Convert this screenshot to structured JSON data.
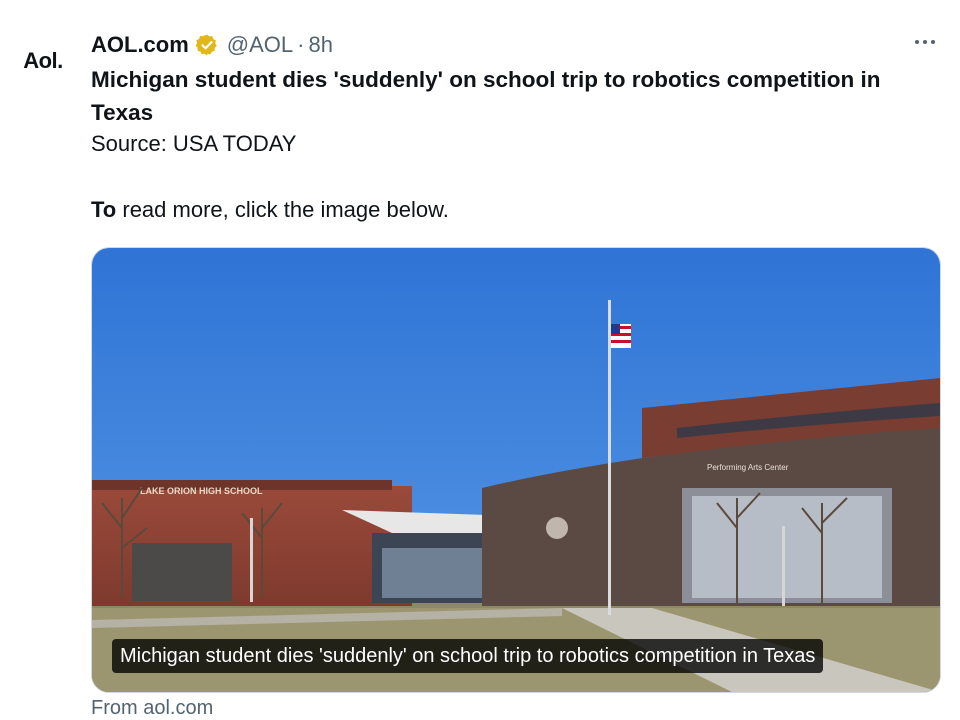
{
  "tweet": {
    "avatar_text": "Aol.",
    "author": "AOL.com",
    "handle": "@AOL",
    "separator": "·",
    "time": "8h",
    "headline": "Michigan student dies 'suddenly' on school trip to robotics competition in Texas",
    "source": "Source: USA TODAY",
    "cta_bold": "To",
    "cta_rest": " read more, click the image below.",
    "from": "From aol.com"
  },
  "media": {
    "caption": "Michigan student dies 'suddenly' on school trip to robotics competition in Texas",
    "building_sign_left": "LAKE ORION HIGH SCHOOL",
    "building_sign_right": "Performing Arts Center"
  },
  "icons": {
    "verified": "verified-gold-badge-icon",
    "more": "more-horizontal-icon"
  },
  "colors": {
    "text_primary": "#0f1419",
    "text_secondary": "#536471",
    "verified_gold": "#e2b719",
    "sky": "#3a7fd9"
  }
}
